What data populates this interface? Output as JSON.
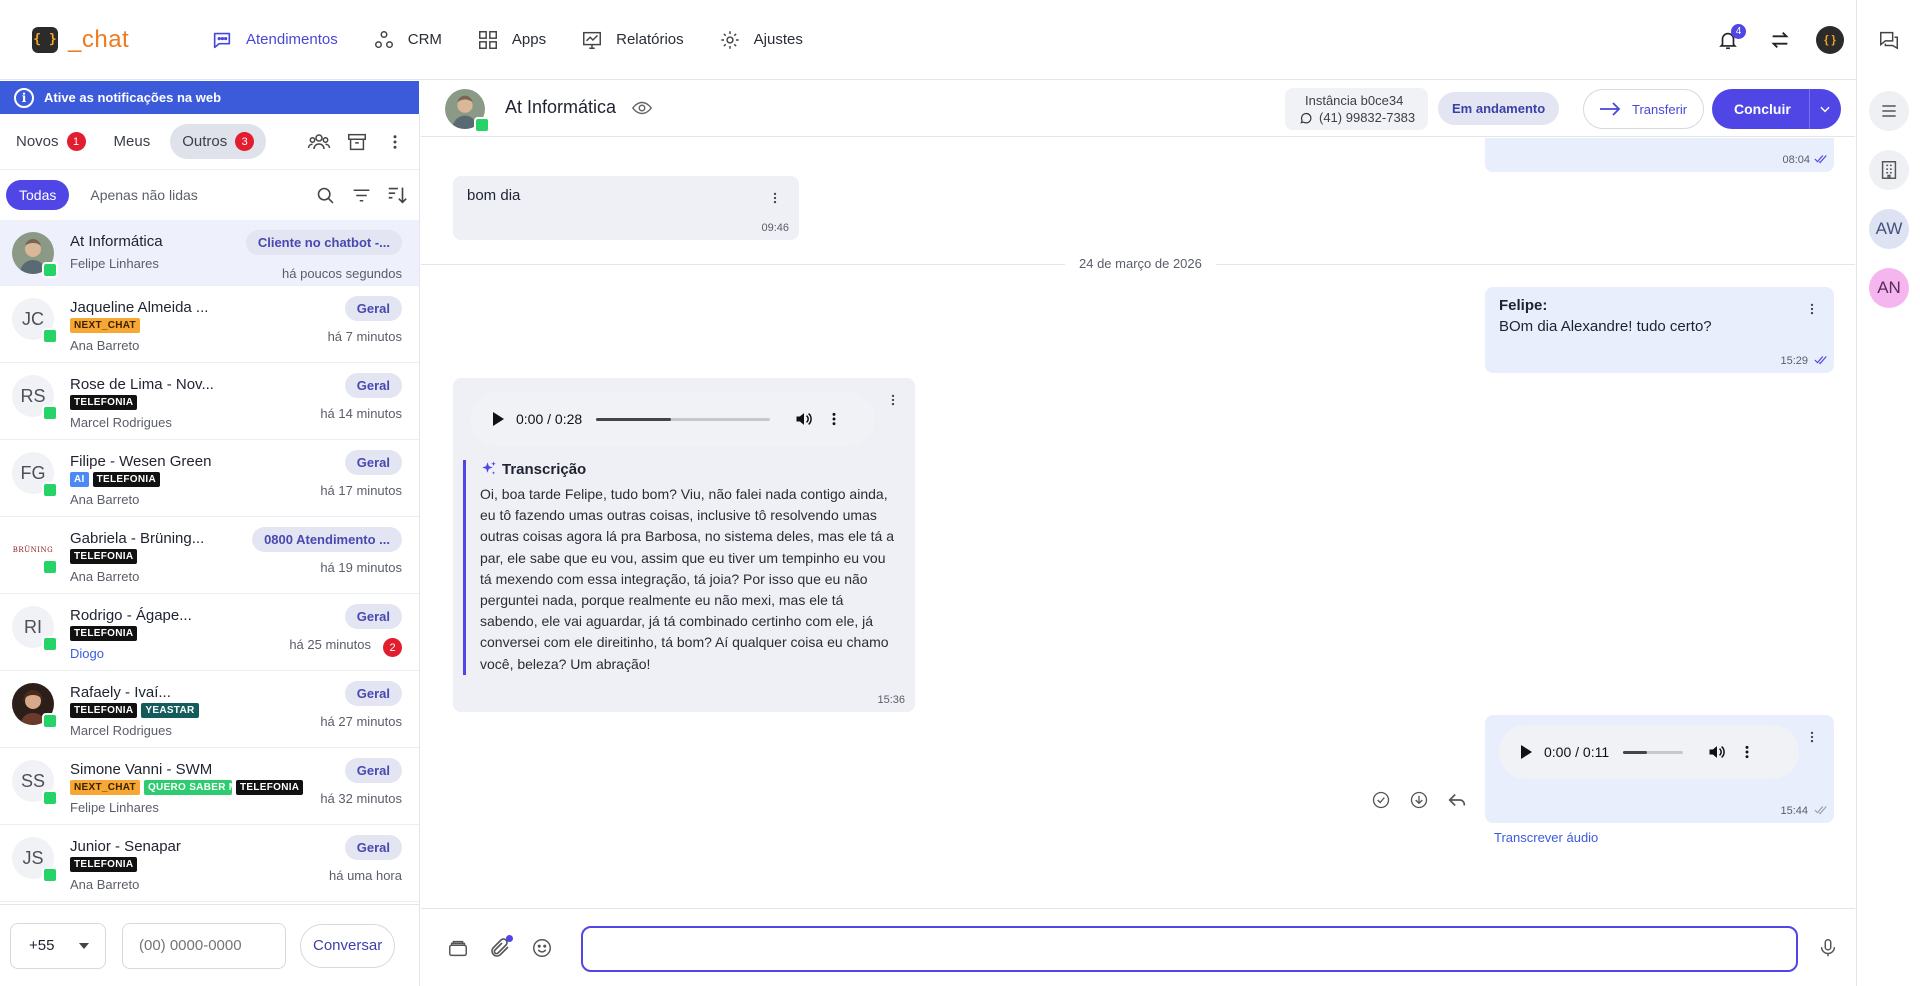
{
  "app": {
    "logo_glyph": "{ }",
    "logo_text": "_chat"
  },
  "nav": {
    "items": [
      {
        "label": "Atendimentos",
        "icon": "chat-bubble-icon",
        "active": true
      },
      {
        "label": "CRM",
        "icon": "crm-nodes-icon"
      },
      {
        "label": "Apps",
        "icon": "apps-grid-icon"
      },
      {
        "label": "Relatórios",
        "icon": "report-chart-icon"
      },
      {
        "label": "Ajustes",
        "icon": "gear-icon"
      }
    ],
    "notifications_count": "4",
    "avatar_glyph": "{ }"
  },
  "banner": {
    "text": "Ative as notificações na web",
    "icon_glyph": "i"
  },
  "tabs": [
    {
      "label": "Novos",
      "count": "1"
    },
    {
      "label": "Meus",
      "count": ""
    },
    {
      "label": "Outros",
      "count": "3",
      "active": true
    }
  ],
  "filters": [
    {
      "label": "Todas",
      "active": true
    },
    {
      "label": "Apenas não lidas"
    }
  ],
  "conversations": [
    {
      "name": "At Informática",
      "initials": "",
      "agent": "Felipe Linhares",
      "pill": "Cliente no chatbot -...",
      "time": "há poucos segundos",
      "tags": [],
      "selected": true,
      "photo": true
    },
    {
      "name": "Jaqueline Almeida ...",
      "initials": "JC",
      "agent": "Ana Barreto",
      "pill": "Geral",
      "time": "há 7 minutos",
      "tags": [
        "NEXT_CHAT"
      ]
    },
    {
      "name": "Rose de Lima - Nov...",
      "initials": "RS",
      "agent": "Marcel Rodrigues",
      "pill": "Geral",
      "time": "há 14 minutos",
      "tags": [
        "TELEFONIA"
      ]
    },
    {
      "name": "Filipe - Wesen Green",
      "initials": "FG",
      "agent": "Ana Barreto",
      "pill": "Geral",
      "time": "há 17 minutos",
      "tags": [
        "AI",
        "TELEFONIA"
      ]
    },
    {
      "name": "Gabriela - Brüning...",
      "initials": "BRÜNING",
      "agent": "Ana Barreto",
      "pill": "0800 Atendimento ...",
      "time": "há 19 minutos",
      "tags": [
        "TELEFONIA"
      ]
    },
    {
      "name": "Rodrigo - Ágape...",
      "initials": "RI",
      "agent": "Diogo",
      "pill": "Geral",
      "time": "há 25 minutos",
      "tags": [
        "TELEFONIA"
      ],
      "unread": "2"
    },
    {
      "name": "Rafaely - Ivaí...",
      "initials": "",
      "agent": "Marcel Rodrigues",
      "pill": "Geral",
      "time": "há 27 minutos",
      "tags": [
        "TELEFONIA",
        "YEASTAR"
      ],
      "photo": true
    },
    {
      "name": "Simone Vanni - SWM",
      "initials": "SS",
      "agent": "Felipe Linhares",
      "pill": "Geral",
      "time": "há 32 minutos",
      "tags": [
        "NEXT_CHAT",
        "QUERO SABER M/",
        "TELEFONIA"
      ]
    },
    {
      "name": "Junior - Senapar",
      "initials": "JS",
      "agent": "Ana Barreto",
      "pill": "Geral",
      "time": "há uma hora",
      "tags": [
        "TELEFONIA"
      ]
    }
  ],
  "footer": {
    "ddi": "+55",
    "phone_placeholder": "(00) 0000-0000",
    "button": "Conversar"
  },
  "header": {
    "name": "At Informática",
    "instance_label": "Instância b0ce34",
    "instance_phone": "(41) 99832-7383",
    "status": "Em andamento",
    "transfer": "Transferir",
    "conclude": "Concluir"
  },
  "messages": {
    "top_partial_time": "08:04",
    "bom_dia": {
      "text": "bom dia",
      "time": "09:46"
    },
    "date_separator": "24 de março de 2026",
    "felipe": {
      "author": "Felipe:",
      "text": "BOm dia Alexandre! tudo certo?",
      "time": "15:29"
    },
    "audio_in": {
      "time_label": "0:00 / 0:28",
      "progress": 0.43,
      "msg_time": "15:36"
    },
    "transcription": {
      "title": "Transcrição",
      "text": "Oi, boa tarde Felipe, tudo bom? Viu, não falei nada contigo ainda, eu tô fazendo umas outras coisas, inclusive tô resolvendo umas outras coisas agora lá pra Barbosa, no sistema deles, mas ele tá a par, ele sabe que eu vou, assim que eu tiver um tempinho eu vou tá mexendo com essa integração, tá joia? Por isso que eu não perguntei nada, porque realmente eu não mexi, mas ele tá sabendo, ele vai aguardar, já tá combinado certinho com ele, já conversei com ele direitinho, tá bom? Aí qualquer coisa eu chamo você, beleza? Um abração!"
    },
    "audio_out": {
      "time_label": "0:00 / 0:11",
      "progress": 0.4,
      "msg_time": "15:44"
    },
    "transcribe_link": "Transcrever áudio"
  },
  "composer": {
    "placeholder": ""
  },
  "rail": {
    "avatars": [
      "AW",
      "AN"
    ]
  },
  "colors": {
    "accent": "#4f46e5",
    "whatsapp": "#25d366",
    "badge_red": "#e11d2e",
    "banner": "#3b5bdb"
  }
}
